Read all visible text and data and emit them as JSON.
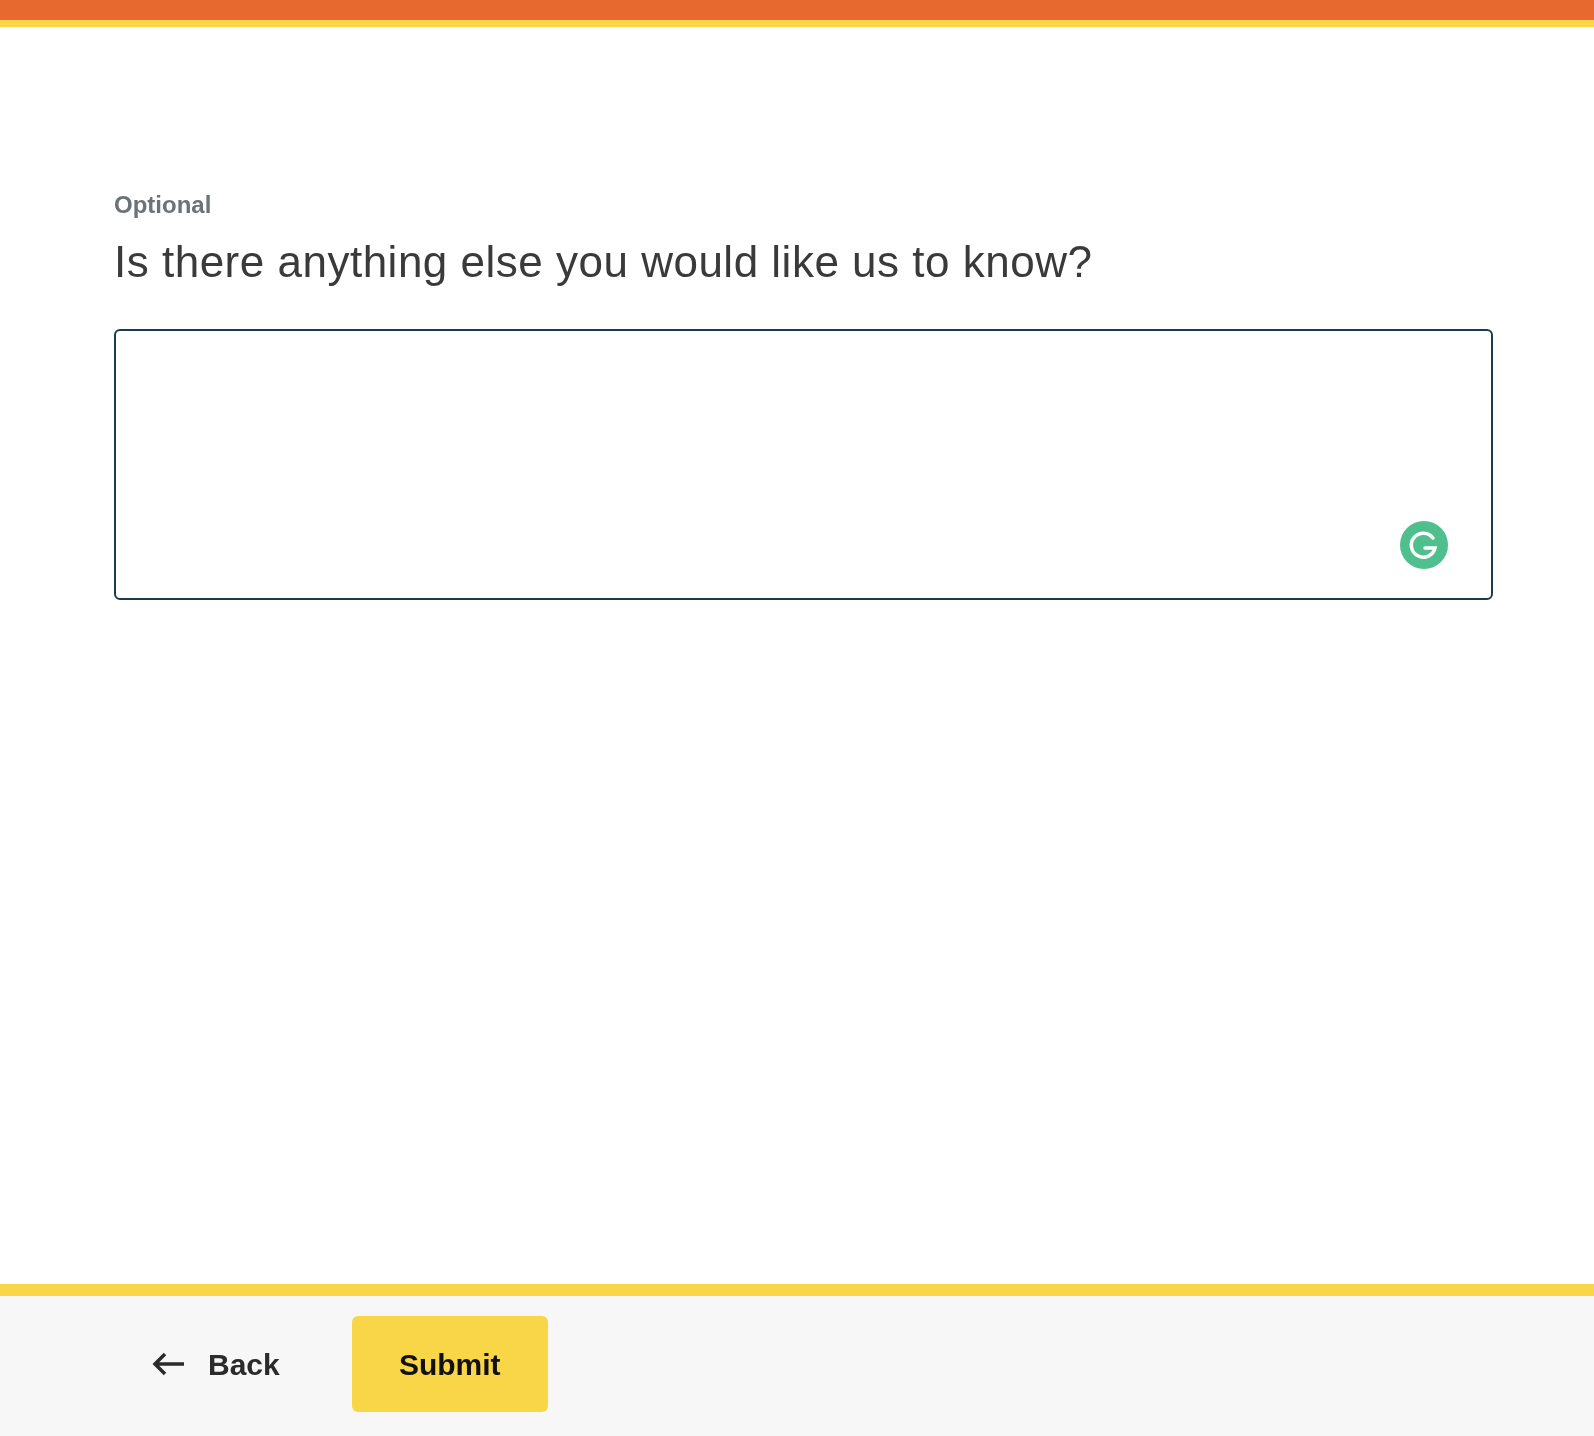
{
  "question": {
    "tag": "Optional",
    "text": "Is there anything else you would like us to know?"
  },
  "footer": {
    "back": "Back",
    "submit": "Submit"
  }
}
